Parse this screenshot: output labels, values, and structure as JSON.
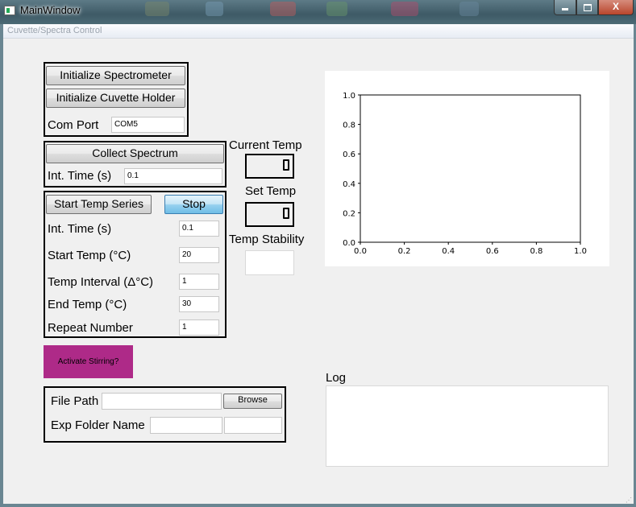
{
  "window": {
    "title": "MainWindow",
    "close_glyph": "X"
  },
  "tab": {
    "label": "Cuvette/Spectra Control"
  },
  "init": {
    "init_spectrometer": "Initialize Spectrometer",
    "init_cuvette": "Initialize Cuvette Holder",
    "com_port_label": "Com Port",
    "com_port_value": "COM5"
  },
  "collect": {
    "button": "Collect Spectrum",
    "int_time_label": "Int. Time (s)",
    "int_time_value": "0.1"
  },
  "series": {
    "start_button": "Start Temp Series",
    "stop_button": "Stop",
    "rows": [
      {
        "label": "Int. Time (s)",
        "value": "0.1"
      },
      {
        "label": "Start Temp (°C)",
        "value": "20"
      },
      {
        "label": "Temp Interval (Δ°C)",
        "value": "1"
      },
      {
        "label": "End Temp (°C)",
        "value": "30"
      },
      {
        "label": "Repeat Number",
        "value": "1"
      }
    ]
  },
  "temps": {
    "current_label": "Current Temp",
    "set_label": "Set Temp",
    "stability_label": "Temp Stability"
  },
  "stir": {
    "label": "Activate Stirring?",
    "color": "#ae2a88"
  },
  "files": {
    "path_label": "File Path",
    "path_value": "",
    "browse": "Browse",
    "folder_label": "Exp Folder Name",
    "folder_value": "",
    "folder_value_2": ""
  },
  "log": {
    "label": "Log",
    "content": ""
  },
  "chart_data": {
    "type": "line",
    "series": [],
    "xlim": [
      0.0,
      1.0
    ],
    "ylim": [
      0.0,
      1.0
    ],
    "xticks": [
      "0.0",
      "0.2",
      "0.4",
      "0.6",
      "0.8",
      "1.0"
    ],
    "yticks": [
      "0.0",
      "0.2",
      "0.4",
      "0.6",
      "0.8",
      "1.0"
    ],
    "title": "",
    "xlabel": "",
    "ylabel": "",
    "grid": false
  }
}
